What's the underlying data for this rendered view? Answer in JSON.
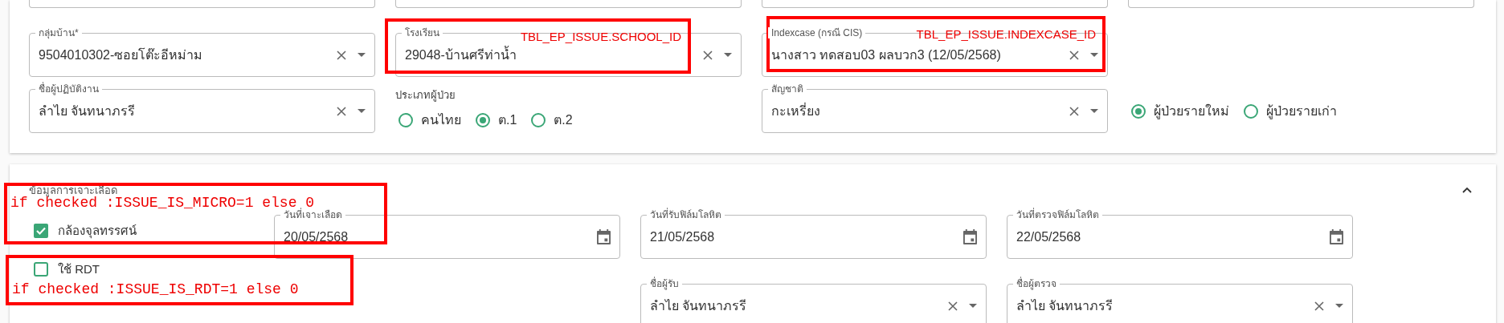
{
  "patient_form": {
    "rows": [
      [
        {
          "kind": "select",
          "label": "กลุ่มบ้าน*",
          "value": "9504010302-ซอยโต๊ะอีหม่าม"
        },
        {
          "kind": "select",
          "label": "โรงเรียน",
          "value": "29048-บ้านศรีท่าน้ำ"
        },
        {
          "kind": "select",
          "label": "Indexcase (กรณี CIS)",
          "value": "นางสาว ทดสอบ03 ผลบวก3 (12/05/2568)"
        }
      ],
      [
        {
          "kind": "select",
          "label": "ชื่อผู้ปฏิบัติงาน",
          "value": "ลำไย จันทนาภรรี"
        },
        {
          "kind": "radio_group",
          "label": "ประเภทผู้ป่วย",
          "options": [
            {
              "label": "คนไทย",
              "selected": false
            },
            {
              "label": "ต.1",
              "selected": true
            },
            {
              "label": "ต.2",
              "selected": false
            }
          ]
        },
        {
          "kind": "select",
          "label": "สัญชาติ",
          "value": "กะเหรี่ยง"
        },
        {
          "kind": "radio_group",
          "options": [
            {
              "label": "ผู้ป่วยรายใหม่",
              "selected": true
            },
            {
              "label": "ผู้ป่วยรายเก่า",
              "selected": false
            }
          ]
        }
      ]
    ]
  },
  "blood_section": {
    "title": "ข้อมูลการเจาะเลือด",
    "expanded": true,
    "checkboxes": [
      {
        "label": "กล้องจุลทรรศน์",
        "checked": true
      },
      {
        "label": "ใช้ RDT",
        "checked": false
      }
    ],
    "rows": [
      [
        {
          "kind": "date",
          "label": "วันที่เจาะเลือด",
          "value": "20/05/2568"
        },
        {
          "kind": "date",
          "label": "วันที่รับฟิล์มโลหิต",
          "value": "21/05/2568"
        },
        {
          "kind": "date",
          "label": "วันที่ตรวจฟิล์มโลหิต",
          "value": "22/05/2568"
        }
      ],
      [
        {
          "kind": "empty"
        },
        {
          "kind": "select",
          "label": "ชื่อผู้รับ",
          "value": "ลำไย จันทนาภรรี"
        },
        {
          "kind": "select",
          "label": "ชื่อผู้ตรวจ",
          "value": "ลำไย จันทนาภรรี"
        }
      ]
    ]
  },
  "annotations": [
    {
      "text": "TBL_EP_ISSUE.SCHOOL_ID",
      "kind": "sans"
    },
    {
      "text": "TBL_EP_ISSUE.INDEXCASE_ID",
      "kind": "sans"
    },
    {
      "text": "if checked :ISSUE_IS_MICRO=1 else 0",
      "kind": "mono"
    },
    {
      "text": "if checked :ISSUE_IS_RDT=1 else 0",
      "kind": "mono"
    }
  ]
}
